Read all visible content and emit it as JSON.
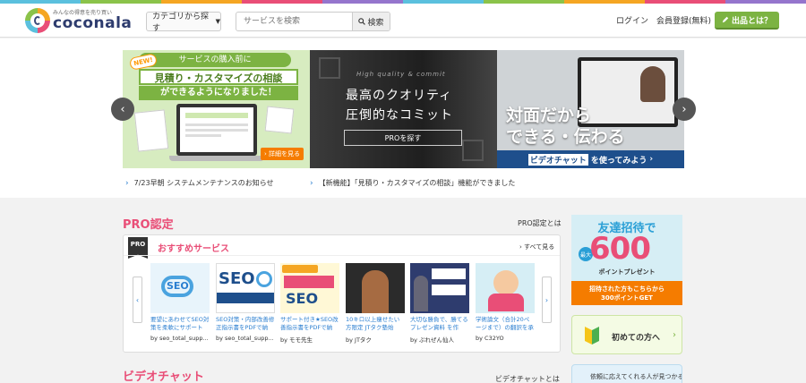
{
  "colors": {
    "brand_navy": "#2e3c6e",
    "accent_pink": "#e94e77",
    "accent_green": "#7cb342",
    "accent_orange": "#f57c00",
    "link_blue": "#2a7ed0",
    "stripe": [
      "#5bc0de",
      "#8bc34a",
      "#f5a623",
      "#e94e77",
      "#9575cd",
      "#5bc0de",
      "#8bc34a",
      "#f5a623",
      "#e94e77",
      "#9575cd"
    ]
  },
  "header": {
    "logo_tagline": "みんなの得意を売り買い",
    "logo_word": "coconala",
    "category_button": "カテゴリから探す",
    "search_placeholder": "サービスを検索",
    "search_button": "検索",
    "login": "ログイン",
    "register": "会員登録(無料)",
    "sell_button": "出品とは？"
  },
  "hero": {
    "banner1": {
      "new_badge": "NEW!",
      "line1": "サービスの購入前に",
      "line2": "見積り・カスタマイズの相談",
      "line3": "ができるようになりました！",
      "more": "詳細を見る"
    },
    "banner2": {
      "label": "High quality & commit",
      "line1": "最高のクオリティ",
      "line2": "圧倒的なコミット",
      "button": "PROを探す"
    },
    "banner3": {
      "line1": "対面だから",
      "line2": "できる・伝わる",
      "bar_highlight": "ビデオチャット",
      "bar_rest": "を使ってみよう"
    },
    "news": [
      "7/23早朝 システムメンテナンスのお知らせ",
      "【新機能】「見積り・カスタマイズの相談」機能ができました"
    ]
  },
  "pro": {
    "heading": "PRO認定",
    "about_link": "PRO認定とは",
    "badge": "PRO",
    "rec_title": "おすすめサービス",
    "see_all": "すべて見る",
    "services": [
      {
        "title": "要望にあわせてSEO対策を柔軟にサポート",
        "seller": "by seo_total_supp..."
      },
      {
        "title": "SEO対策・内部改善修正指示書をPDFで納",
        "seller": "by seo_total_supp..."
      },
      {
        "title": "サポート付き★SEO改善指示書をPDFで納",
        "seller": "by モモ先生"
      },
      {
        "title": "10キロ以上痩せたい方限定 JTタク塾始",
        "seller": "by JTタク"
      },
      {
        "title": "大切な勝負で、勝てるプレゼン資料 を作",
        "seller": "by ぷれぜん仙人"
      },
      {
        "title": "学術論文（合計20ページまで）の翻訳を承",
        "seller": "by C32YO"
      }
    ]
  },
  "video": {
    "heading": "ビデオチャット",
    "about_link": "ビデオチャットとは"
  },
  "sidebar": {
    "invite_title": "友達招待で",
    "invite_max": "最大",
    "invite_points": "600",
    "invite_present": "ポイントプレゼント",
    "invite_lower1": "招待された方もこちらから",
    "invite_lower2": "300ポイントGET",
    "first_time": "初めての方へ",
    "bottom_text": "依頼に応えてくれる人が見つかる"
  }
}
